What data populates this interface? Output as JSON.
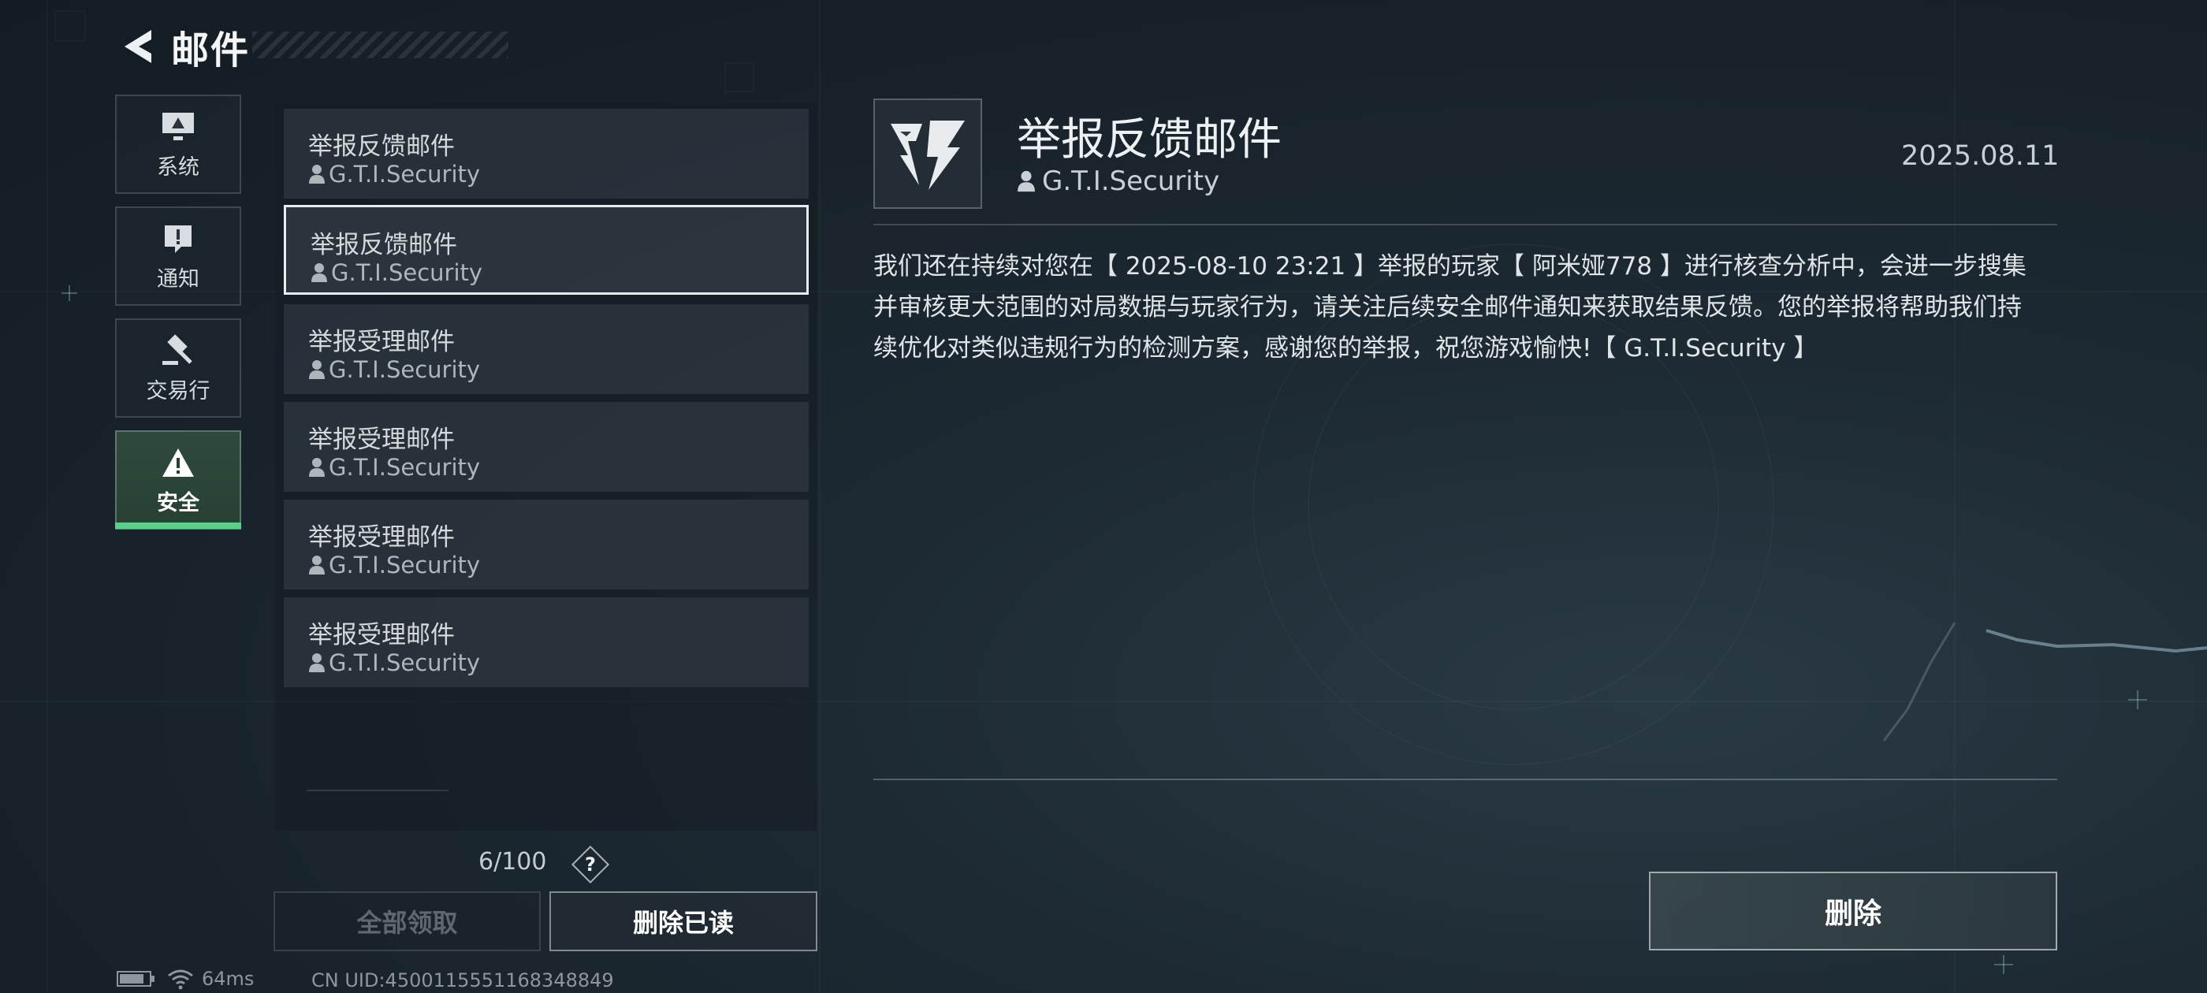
{
  "header": {
    "title": "邮件",
    "back_icon": "back-arrow-icon"
  },
  "categories": [
    {
      "label": "系统",
      "icon": "monitor-icon",
      "active": false
    },
    {
      "label": "通知",
      "icon": "exclamation-icon",
      "active": false
    },
    {
      "label": "交易行",
      "icon": "gavel-icon",
      "active": false
    },
    {
      "label": "安全",
      "icon": "warning-triangle-icon",
      "active": true
    }
  ],
  "mail_list": [
    {
      "title": "举报反馈邮件",
      "sender": "G.T.I.Security",
      "selected": false
    },
    {
      "title": "举报反馈邮件",
      "sender": "G.T.I.Security",
      "selected": true
    },
    {
      "title": "举报受理邮件",
      "sender": "G.T.I.Security",
      "selected": false
    },
    {
      "title": "举报受理邮件",
      "sender": "G.T.I.Security",
      "selected": false
    },
    {
      "title": "举报受理邮件",
      "sender": "G.T.I.Security",
      "selected": false
    },
    {
      "title": "举报受理邮件",
      "sender": "G.T.I.Security",
      "selected": false
    }
  ],
  "footer": {
    "count": "6/100",
    "help_label": "?",
    "claim_all": "全部领取",
    "delete_read": "删除已读",
    "ping": "64ms",
    "uid": "CN UID:4500115551168348849"
  },
  "detail": {
    "title": "举报反馈邮件",
    "sender": "G.T.I.Security",
    "date": "2025.08.11",
    "body": "我们还在持续对您在【 2025-08-10 23:21 】举报的玩家【 阿米娅778 】进行核查分析中，会进一步搜集并审核更大范围的对局数据与玩家行为，请关注后续安全邮件通知来获取结果反馈。您的举报将帮助我们持续优化对类似违规行为的检测方案，感谢您的举报，祝您游戏愉快!【 G.T.I.Security 】",
    "delete_label": "删除"
  },
  "colors": {
    "accent": "#5bd08a",
    "background": "#1a252e"
  }
}
